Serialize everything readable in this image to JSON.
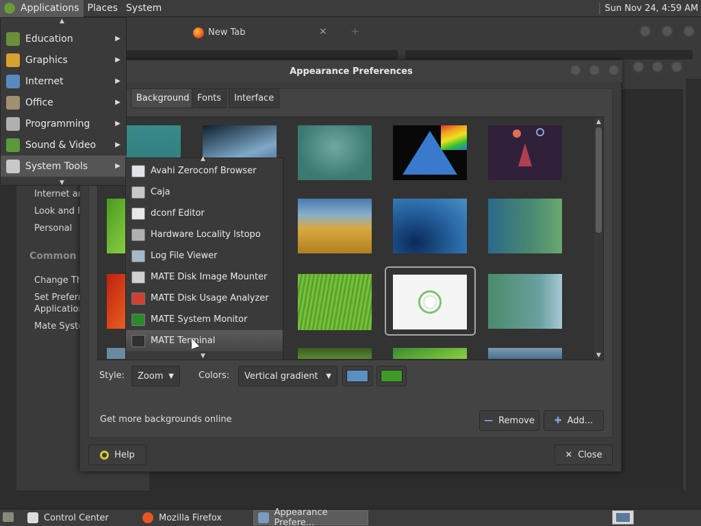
{
  "top_panel": {
    "menus": [
      "Applications",
      "Places",
      "System"
    ],
    "clock": "Sun Nov 24,  4:59 AM"
  },
  "firefox": {
    "tab_title": "New Tab",
    "tab_close": "×",
    "new_tab": "+"
  },
  "control_center": {
    "items": [
      "Internet an",
      "Look and F",
      "Personal"
    ],
    "common_heading": "Common T",
    "common_items": [
      "Change Th",
      "Set Preferre",
      "Application",
      "Mate Syster"
    ]
  },
  "dialog": {
    "title": "Appearance Preferences",
    "tabs": [
      "Background",
      "Fonts",
      "Interface"
    ],
    "active_tab": "Background",
    "style_label": "Style:",
    "style_value": "Zoom",
    "colors_label": "Colors:",
    "colors_value": "Vertical gradient",
    "color1": "#5b8fc0",
    "color2": "#3e9b2a",
    "more_link": "Get more backgrounds online",
    "remove_label": "Remove",
    "add_label": "Add...",
    "help_label": "Help",
    "close_label": "Close",
    "selected_thumbnail": 7
  },
  "app_menu": {
    "items": [
      {
        "label": "Education",
        "icon": "education-icon",
        "color": "#6b8e3a"
      },
      {
        "label": "Graphics",
        "icon": "graphics-icon",
        "color": "#d8a030"
      },
      {
        "label": "Internet",
        "icon": "internet-icon",
        "color": "#5a8ac0"
      },
      {
        "label": "Office",
        "icon": "office-icon",
        "color": "#a09070"
      },
      {
        "label": "Programming",
        "icon": "programming-icon",
        "color": "#b0b0b0"
      },
      {
        "label": "Sound & Video",
        "icon": "sound-video-icon",
        "color": "#5a9a3a"
      },
      {
        "label": "System Tools",
        "icon": "system-tools-icon",
        "color": "#c8c8c8"
      }
    ],
    "active": "System Tools"
  },
  "system_tools": {
    "items": [
      {
        "label": "Avahi Zeroconf Browser",
        "icon": "avahi-icon"
      },
      {
        "label": "Caja",
        "icon": "caja-icon"
      },
      {
        "label": "dconf Editor",
        "icon": "dconf-icon"
      },
      {
        "label": "Hardware Locality lstopo",
        "icon": "hardware-icon"
      },
      {
        "label": "Log File Viewer",
        "icon": "log-viewer-icon"
      },
      {
        "label": "MATE Disk Image Mounter",
        "icon": "disk-mounter-icon"
      },
      {
        "label": "MATE Disk Usage Analyzer",
        "icon": "disk-usage-icon"
      },
      {
        "label": "MATE System Monitor",
        "icon": "system-monitor-icon"
      },
      {
        "label": "MATE Terminal",
        "icon": "terminal-icon"
      }
    ],
    "hovered": "MATE Terminal"
  },
  "taskbar": {
    "tasks": [
      {
        "label": "Control Center",
        "icon": "control-center-icon"
      },
      {
        "label": "Mozilla Firefox",
        "icon": "firefox-icon"
      },
      {
        "label": "Appearance Prefere...",
        "icon": "appearance-icon"
      }
    ],
    "active": "Appearance Prefere..."
  }
}
